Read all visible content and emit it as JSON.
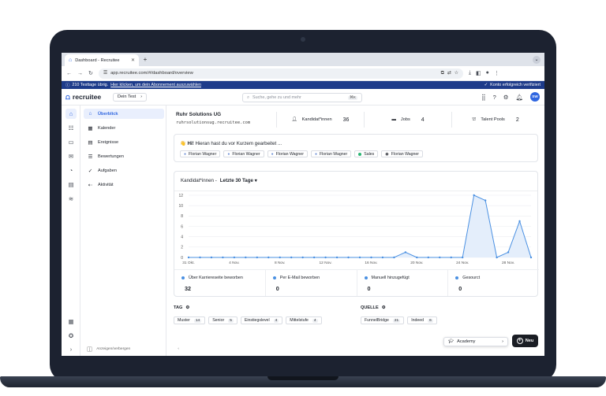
{
  "browser": {
    "tab_title": "Dashboard - Recruitee",
    "url": "app.recruitee.com/#/dashboard/overview"
  },
  "notice": {
    "trial_text": "210 Testtage übrig.",
    "trial_link": "Hier klicken, um dein Abonnement auszuwählen",
    "account_status": "Konto erfolgreich verifiziert"
  },
  "header": {
    "logo_text": "recruitee",
    "company_switch": "Dein Test",
    "search_placeholder": "Suche, gehe zu und mehr",
    "search_shortcut": "⌘K",
    "avatar_initials": "SW"
  },
  "subnav": {
    "items": [
      {
        "label": "Überblick",
        "icon": "home-icon",
        "active": true
      },
      {
        "label": "Kalender",
        "icon": "calendar-icon"
      },
      {
        "label": "Ereignisse",
        "icon": "events-icon"
      },
      {
        "label": "Bewertungen",
        "icon": "ratings-icon"
      },
      {
        "label": "Aufgaben",
        "icon": "check-icon"
      },
      {
        "label": "Aktivität",
        "icon": "activity-icon"
      }
    ],
    "collapse_key": "[",
    "collapse_label": "Anzeigen/verbergen"
  },
  "company": {
    "name": "Ruhr Solutions UG",
    "domain": "ruhrsolutionsug.recruitee.com"
  },
  "stats": [
    {
      "label": "Kandidat*innen",
      "value": "36",
      "icon": "users-icon"
    },
    {
      "label": "Jobs",
      "value": "4",
      "icon": "briefcase-icon"
    },
    {
      "label": "Talent Pools",
      "value": "2",
      "icon": "talent-pool-icon"
    }
  ],
  "activity": {
    "hi": "Hi!",
    "text": "Hieran hast du vor Kurzem gearbeitet ...",
    "items": [
      {
        "label": "Florian Wagner",
        "icon": "candidate-icon"
      },
      {
        "label": "Florian Wagner",
        "icon": "candidate-icon"
      },
      {
        "label": "Florian Wagner",
        "icon": "candidate-icon"
      },
      {
        "label": "Florian Wagner",
        "icon": "candidate-icon"
      },
      {
        "label": "Sales",
        "icon": "job-dot-icon"
      },
      {
        "label": "Florian Wagner",
        "icon": "avatar-icon"
      }
    ]
  },
  "chart_header": {
    "prefix": "Kandidat*innen -",
    "filter": "Letzte 30 Tage"
  },
  "chart_data": {
    "type": "area",
    "x": [
      "31 Okt.",
      "1 Nov.",
      "2 Nov.",
      "3 Nov.",
      "4 Nov.",
      "5 Nov.",
      "6 Nov.",
      "7 Nov.",
      "8 Nov.",
      "9 Nov.",
      "10 Nov.",
      "11 Nov.",
      "12 Nov.",
      "13 Nov.",
      "14 Nov.",
      "15 Nov.",
      "16 Nov.",
      "17 Nov.",
      "18 Nov.",
      "19 Nov.",
      "20 Nov.",
      "21 Nov.",
      "22 Nov.",
      "23 Nov.",
      "24 Nov.",
      "25 Nov.",
      "26 Nov.",
      "27 Nov.",
      "28 Nov.",
      "29 Nov.",
      "30 Nov."
    ],
    "tick_labels": [
      "31 Okt.",
      "4 Nov.",
      "8 Nov.",
      "12 Nov.",
      "16 Nov.",
      "20 Nov.",
      "24 Nov.",
      "28 Nov."
    ],
    "values": [
      0,
      0,
      0,
      0,
      0,
      0,
      0,
      0,
      0,
      0,
      0,
      0,
      0,
      0,
      0,
      0,
      0,
      0,
      0,
      1,
      0,
      0,
      0,
      0,
      0,
      12,
      11,
      0,
      1,
      7,
      0
    ],
    "y_ticks": [
      0,
      2,
      4,
      6,
      8,
      10,
      12
    ],
    "ylim": [
      0,
      12
    ],
    "grid": true,
    "color": "#4a90e2",
    "fill": "#e4eefb"
  },
  "sources": [
    {
      "label": "Über Karriereseite beworben",
      "value": "32"
    },
    {
      "label": "Per E-Mail beworben",
      "value": "0"
    },
    {
      "label": "Manuell hinzugefügt",
      "value": "0"
    },
    {
      "label": "Gesourct",
      "value": "0"
    }
  ],
  "tags": {
    "heading": "TAG",
    "items": [
      {
        "label": "Muster",
        "count": "14"
      },
      {
        "label": "Senior",
        "count": "5"
      },
      {
        "label": "Einstiegslevel",
        "count": "4"
      },
      {
        "label": "Mittelstufe",
        "count": "4"
      }
    ]
  },
  "sources_section": {
    "heading": "QUELLE",
    "items": [
      {
        "label": "FunnelBridge",
        "count": "21"
      },
      {
        "label": "Indeed",
        "count": "6"
      }
    ]
  },
  "academy": {
    "label": "Academy"
  },
  "new_button": {
    "label": "Neu"
  }
}
